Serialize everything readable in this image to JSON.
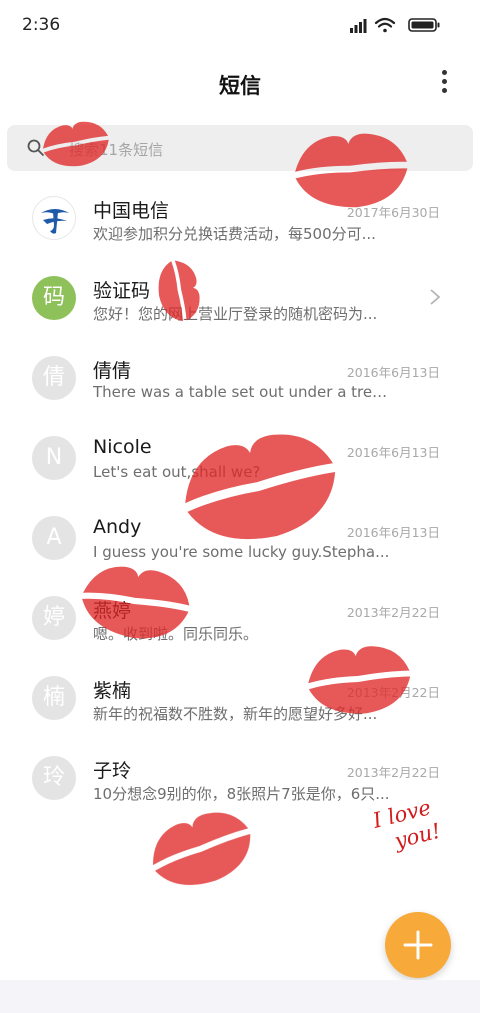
{
  "status_bar": {
    "time": "2:36"
  },
  "header": {
    "title": "短信"
  },
  "search": {
    "placeholder": "搜索11条短信"
  },
  "conversations": [
    {
      "name": "中国电信",
      "date": "2017年6月30日",
      "preview": "欢迎参加积分兑换话费活动，每500分可...",
      "avatar": "china-telecom-logo"
    },
    {
      "name": "验证码",
      "date": "",
      "preview": "您好！您的网上营业厅登录的随机密码为...",
      "avatar_text": "码"
    },
    {
      "name": "倩倩",
      "date": "2016年6月13日",
      "preview": "There was a table set out under a tree i...",
      "avatar_text": "倩"
    },
    {
      "name": "Nicole",
      "date": "2016年6月13日",
      "preview": "Let's eat out,shall we?",
      "avatar_text": "N"
    },
    {
      "name": "Andy",
      "date": "2016年6月13日",
      "preview": "I guess you're some lucky guy.Stepha...",
      "avatar_text": "A"
    },
    {
      "name": "燕婷",
      "date": "2013年2月22日",
      "preview": "嗯。收到啦。同乐同乐。",
      "avatar_text": "婷"
    },
    {
      "name": "紫楠",
      "date": "2013年2月22日",
      "preview": "新年的祝福数不胜数，新年的愿望好多好...",
      "avatar_text": "楠"
    },
    {
      "name": "子玲",
      "date": "2013年2月22日",
      "preview": "10分想念9别的你，8张照片7张是你，6只...",
      "avatar_text": "玲"
    }
  ],
  "decoration": {
    "note_line1": "I love",
    "note_line2": "you!",
    "lipstick_color": "#e02a2a"
  },
  "colors": {
    "accent": "#f7a93a",
    "verify_avatar": "#8ec15a",
    "avatar_default": "#e4e4e4"
  }
}
